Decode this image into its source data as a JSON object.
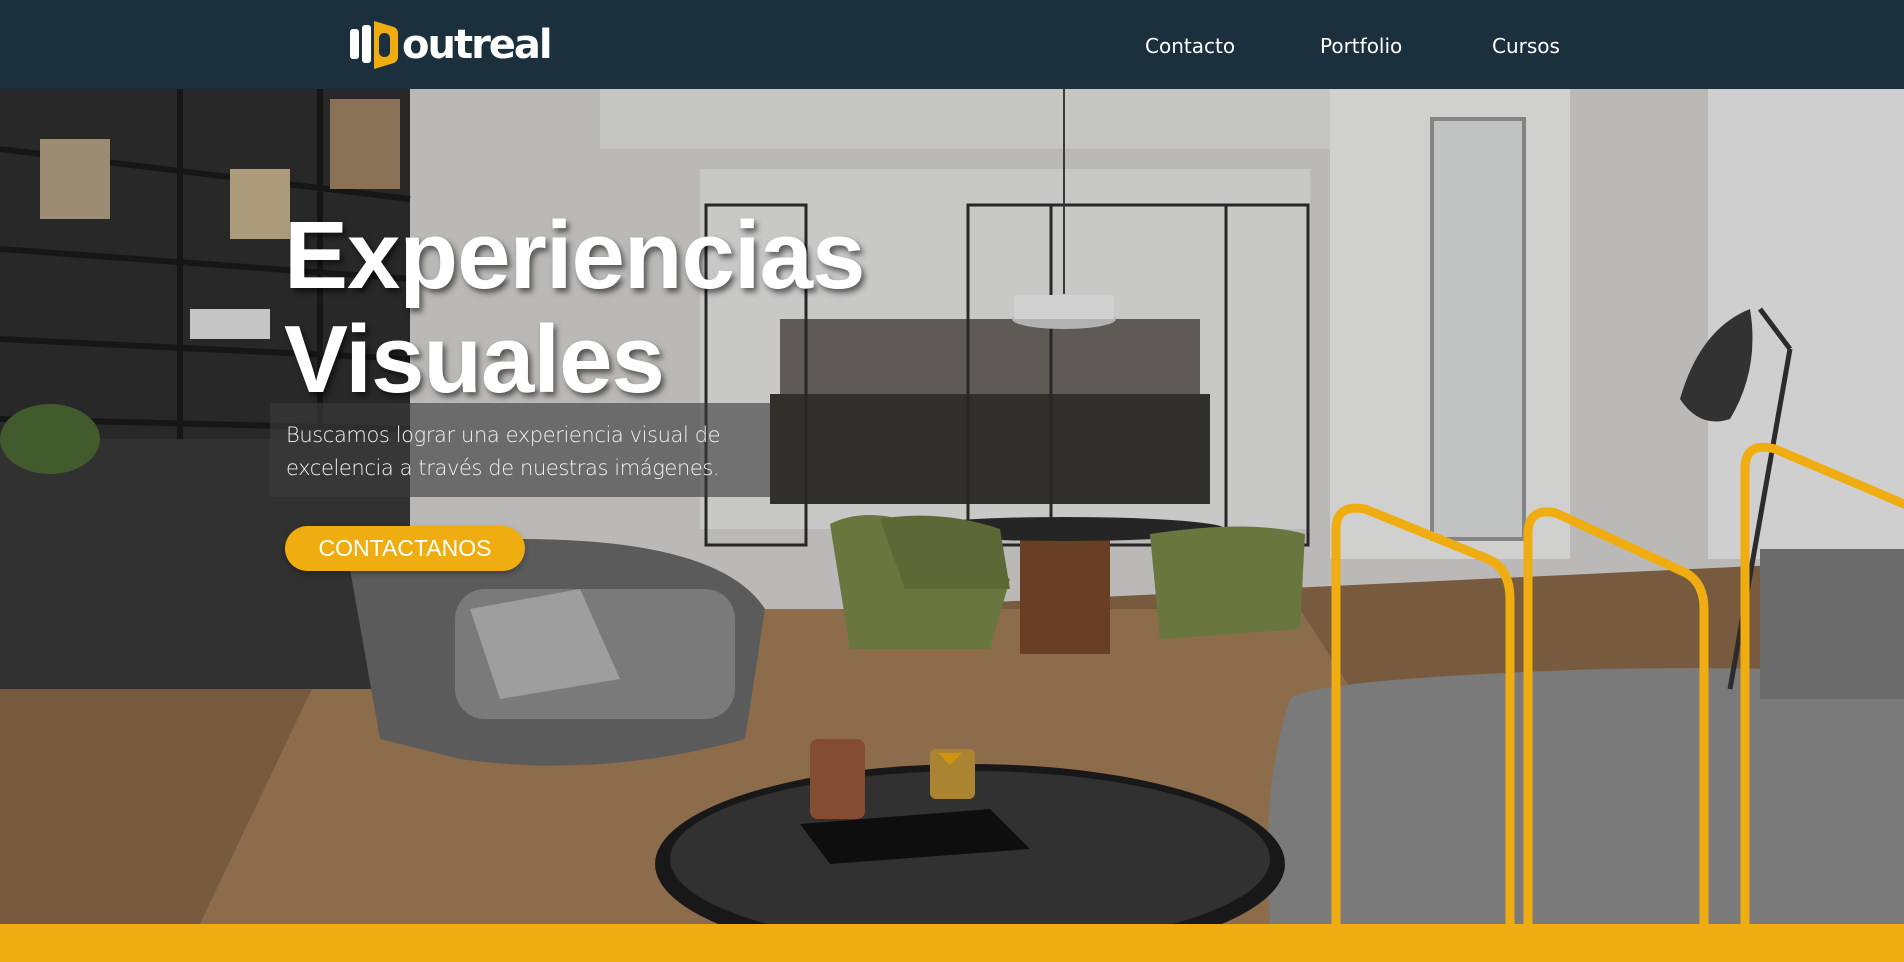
{
  "brand": {
    "name": "outreal",
    "accent_color": "#f0ad11",
    "nav_color": "#1b303c"
  },
  "nav": {
    "links": [
      {
        "label": "Contacto"
      },
      {
        "label": "Portfolio"
      },
      {
        "label": "Cursos"
      }
    ]
  },
  "hero": {
    "title_line1": "Experiencias",
    "title_line2": "Visuales",
    "subtitle_line1": "Buscamos lograr una experiencia visual de",
    "subtitle_line2": "excelencia a través de nuestras imágenes.",
    "cta_label": "CONTACTANOS",
    "background": "interior-living-dining-room-render"
  }
}
